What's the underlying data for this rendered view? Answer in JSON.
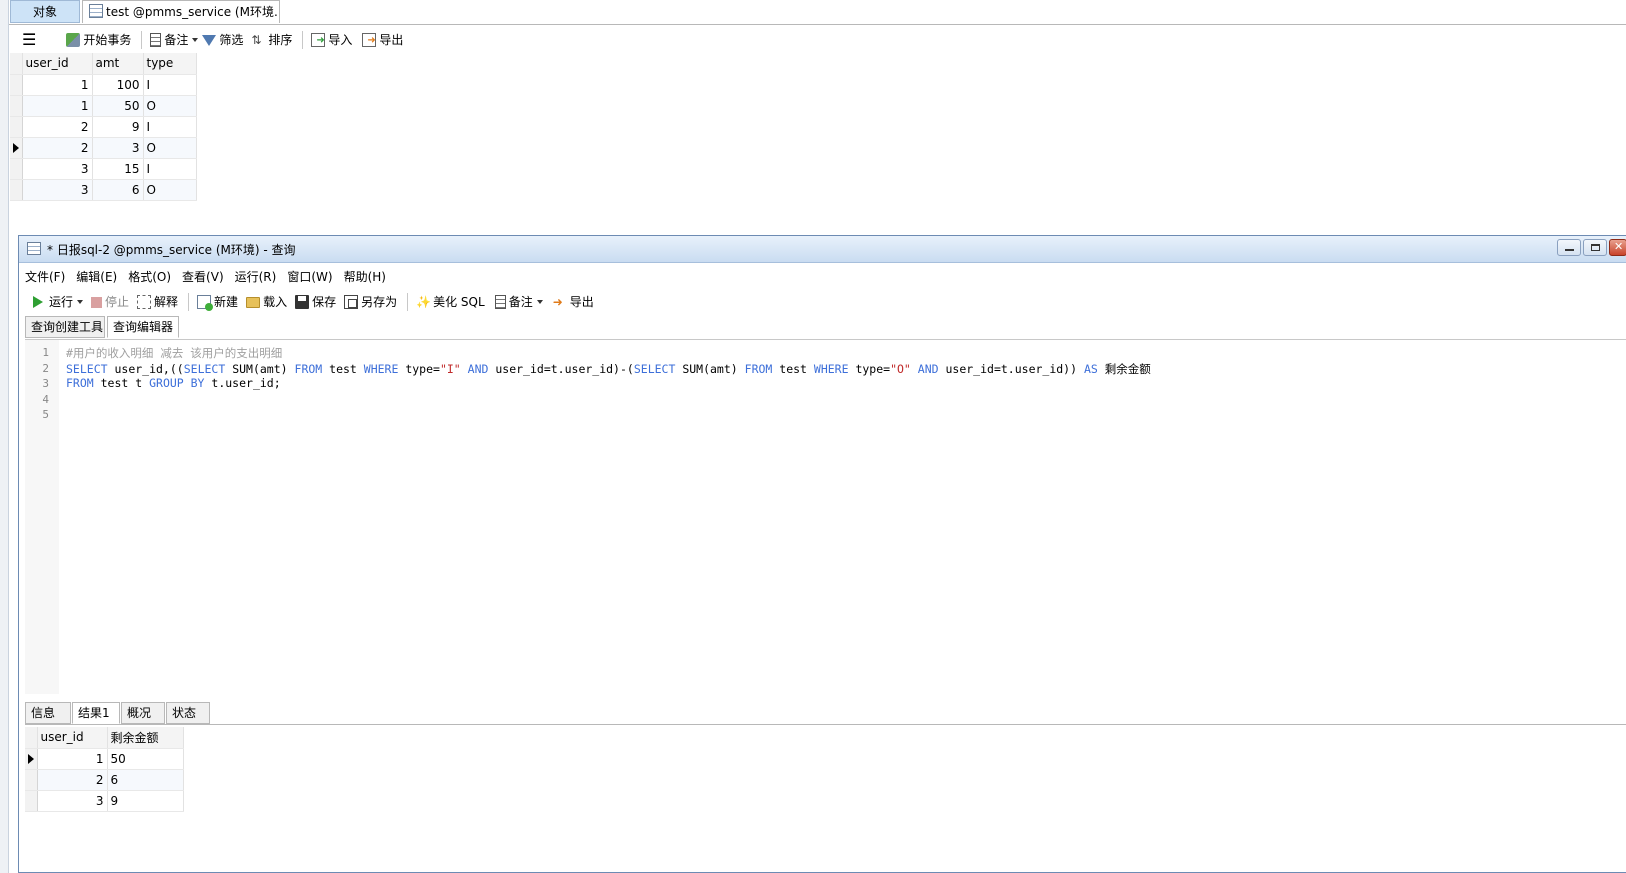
{
  "top_tabs": {
    "objects": "对象",
    "table_tab": "test @pmms_service (M环境..."
  },
  "table_toolbar": {
    "begin_transaction": "开始事务",
    "memo": "备注",
    "filter": "筛选",
    "sort": "排序",
    "import": "导入",
    "export": "导出"
  },
  "table_grid": {
    "columns": [
      "user_id",
      "amt",
      "type"
    ],
    "rows": [
      [
        "1",
        "100",
        "I"
      ],
      [
        "1",
        "50",
        "O"
      ],
      [
        "2",
        "9",
        "I"
      ],
      [
        "2",
        "3",
        "O"
      ],
      [
        "3",
        "15",
        "I"
      ],
      [
        "3",
        "6",
        "O"
      ]
    ]
  },
  "query_window": {
    "title": "* 日报sql-2 @pmms_service (M环境) - 查询",
    "menu": [
      "文件(F)",
      "编辑(E)",
      "格式(O)",
      "查看(V)",
      "运行(R)",
      "窗口(W)",
      "帮助(H)"
    ],
    "toolbar": {
      "run": "运行",
      "stop": "停止",
      "explain": "解释",
      "new": "新建",
      "load": "载入",
      "save": "保存",
      "save_as": "另存为",
      "beautify": "美化 SQL",
      "memo": "备注",
      "export": "导出"
    },
    "sub_tabs": [
      "查询创建工具",
      "查询编辑器"
    ],
    "line_numbers": [
      "1",
      "2",
      "3",
      "4",
      "5"
    ],
    "code": {
      "l1_comment": "#用户的收入明细 减去 该用户的支出明细",
      "l2": [
        "SELECT",
        " user_id,((",
        "SELECT",
        " SUM(amt) ",
        "FROM",
        " test ",
        "WHERE",
        " type=",
        "\"I\"",
        " ",
        "AND",
        " user_id=t.user_id)-(",
        "SELECT",
        " SUM(amt) ",
        "FROM",
        " test ",
        "WHERE",
        " type=",
        "\"O\"",
        " ",
        "AND",
        " user_id=t.user_id)) ",
        "AS",
        " 剩余金额"
      ],
      "l3": [
        "FROM",
        " test t ",
        "GROUP BY",
        " t.user_id;"
      ]
    },
    "result_tabs": [
      "信息",
      "结果1",
      "概况",
      "状态"
    ],
    "result_grid": {
      "columns": [
        "user_id",
        "剩余金额"
      ],
      "rows": [
        [
          "1",
          "50"
        ],
        [
          "2",
          "6"
        ],
        [
          "3",
          "9"
        ]
      ]
    }
  }
}
